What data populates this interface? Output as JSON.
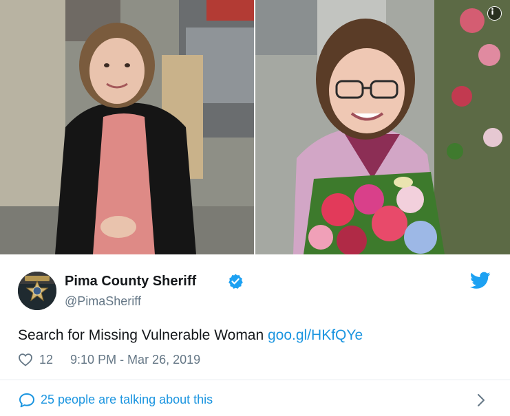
{
  "media": {
    "photo_count": 2,
    "left_photo_subject": "woman-in-pink-dress-and-black-cardigan",
    "right_photo_subject": "woman-with-glasses-holding-flowers",
    "info_icon": "info-icon"
  },
  "author": {
    "display_name": "Pima County Sheriff",
    "handle": "@PimaSheriff",
    "verified": true,
    "avatar_icon": "sheriff-badge-icon"
  },
  "tweet": {
    "text": "Search for Missing Vulnerable Woman ",
    "link": "goo.gl/HKfQYe"
  },
  "meta": {
    "like_count": "12",
    "timestamp": "9:10 PM - Mar 26, 2019"
  },
  "footer": {
    "talking_text": "25 people are talking about this"
  },
  "colors": {
    "link": "#1b95e0",
    "secondary_text": "#657786",
    "primary_text": "#14171a",
    "divider": "#e6ecf0"
  }
}
